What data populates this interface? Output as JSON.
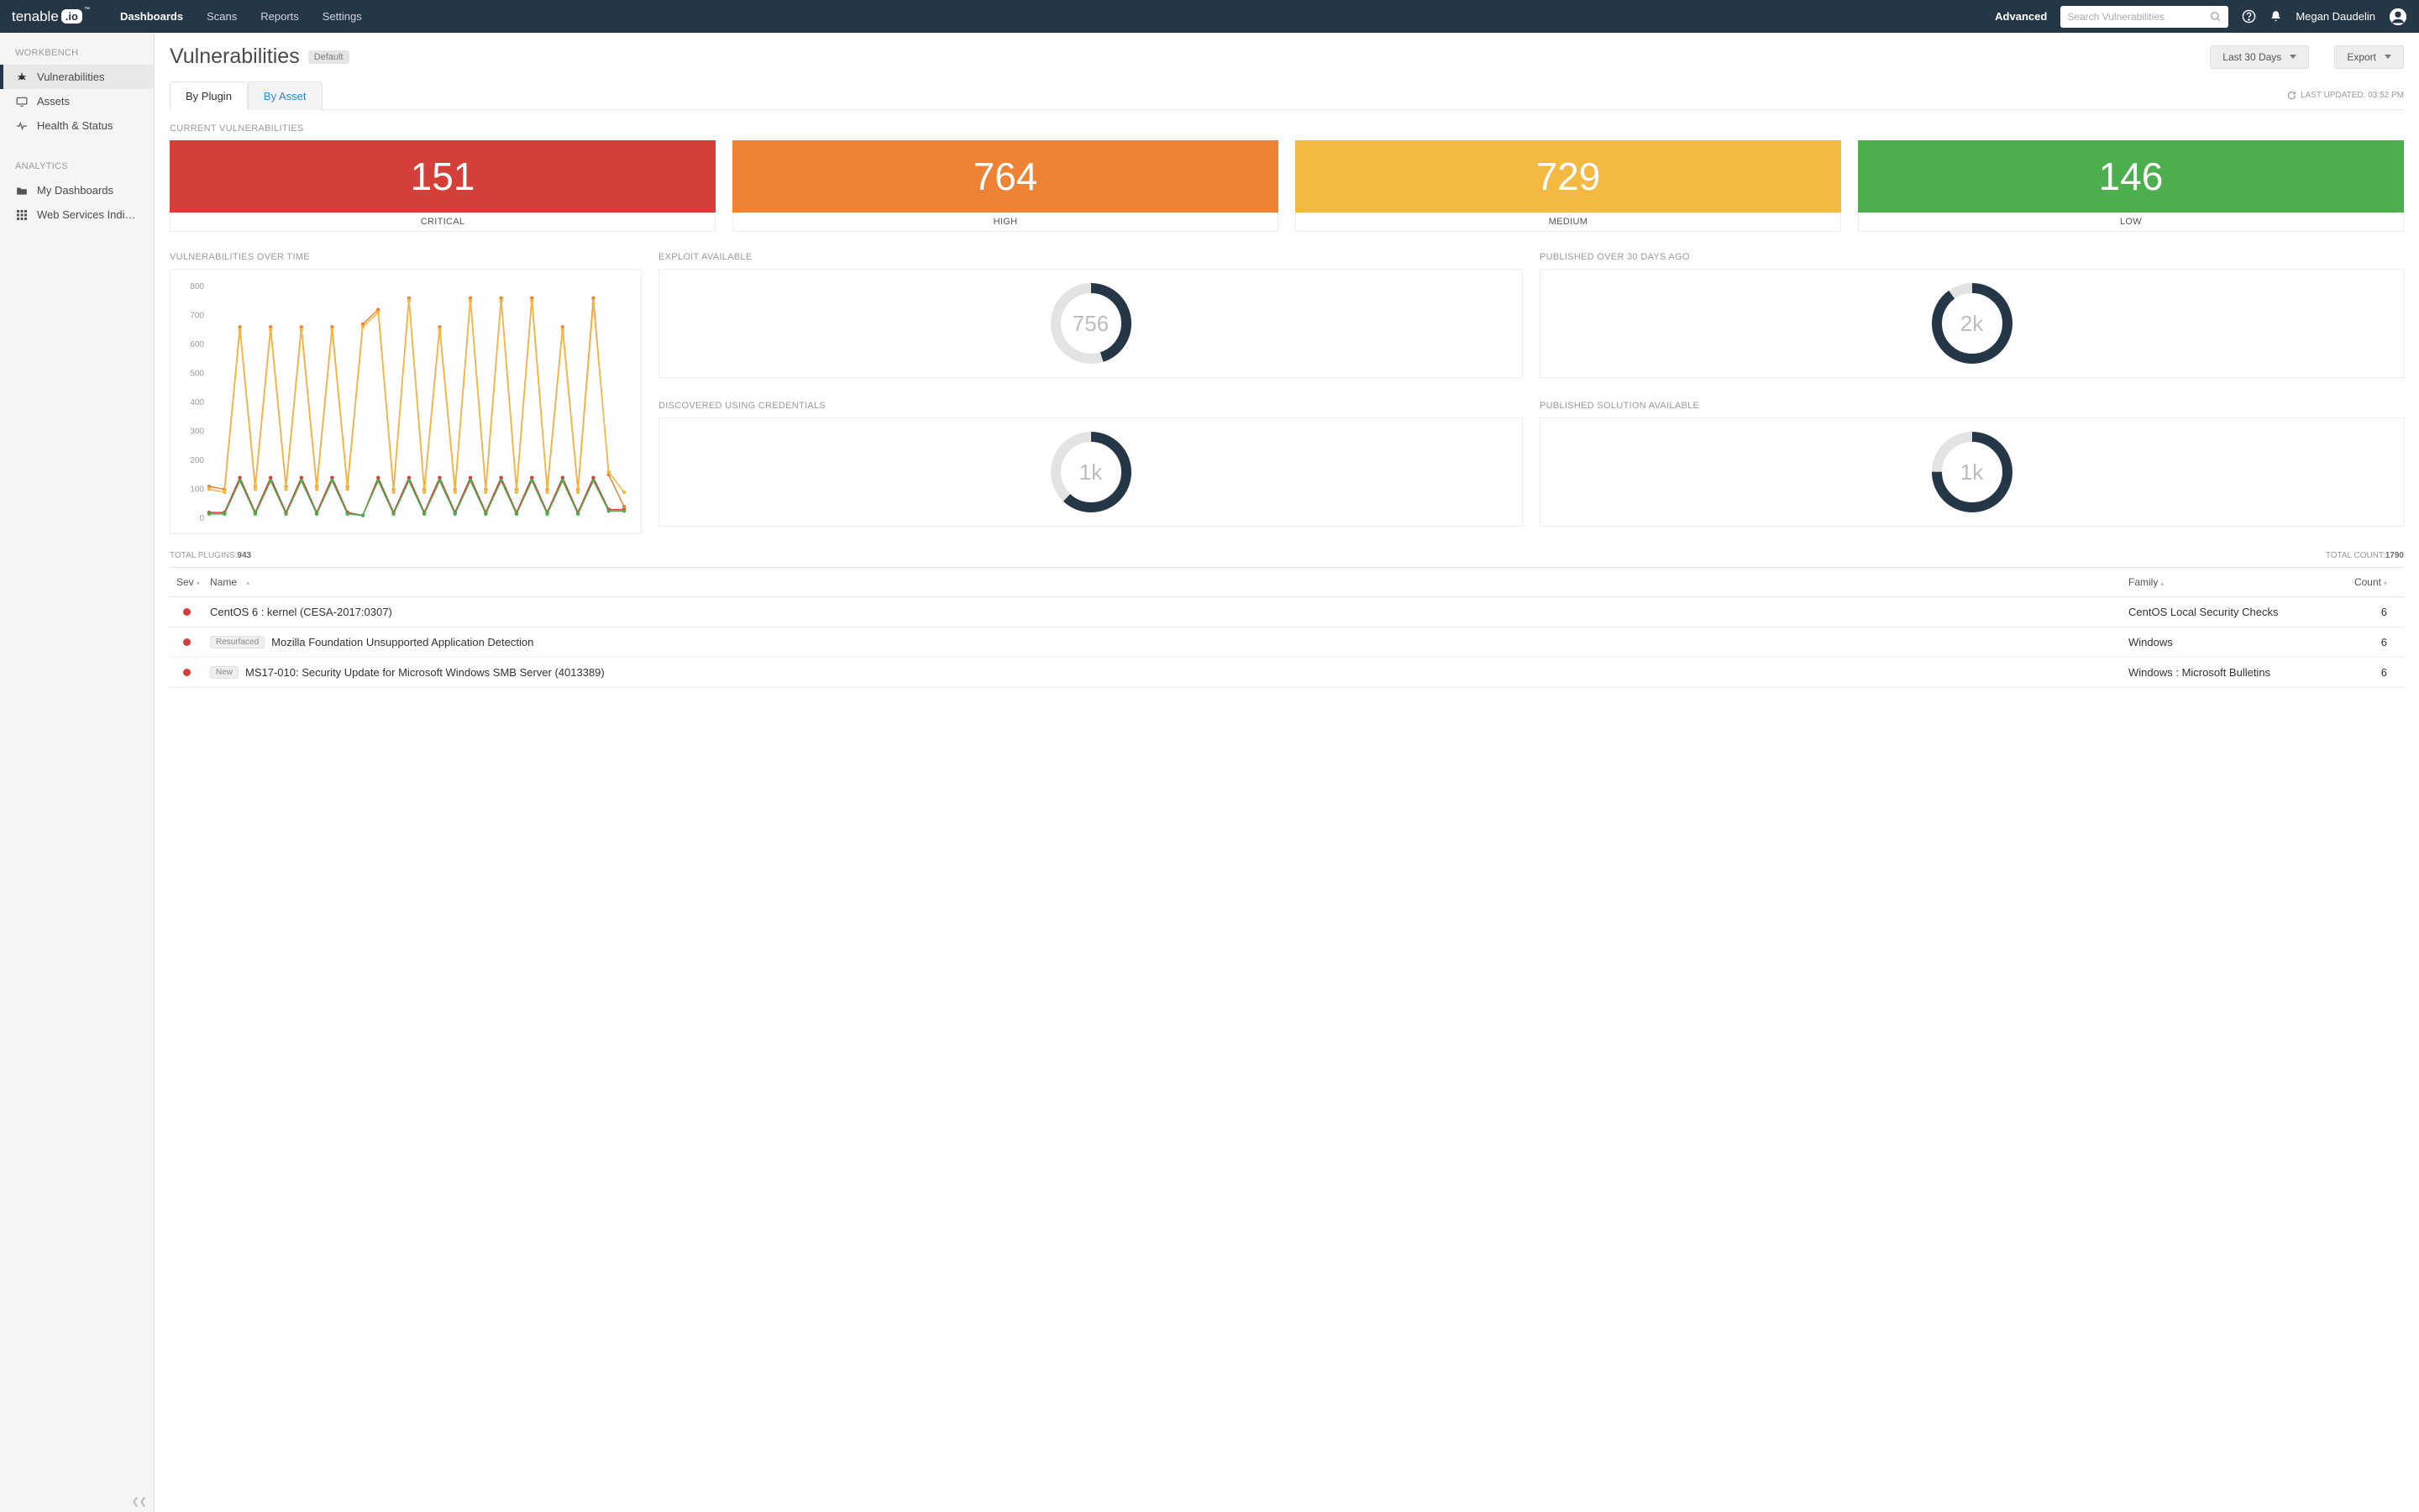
{
  "brand": {
    "left": "tenable",
    "badge": ".io",
    "tm": "™"
  },
  "topnav": [
    "Dashboards",
    "Scans",
    "Reports",
    "Settings"
  ],
  "topnav_active": 0,
  "advanced_label": "Advanced",
  "search_placeholder": "Search Vulnerabilities",
  "username": "Megan Daudelin",
  "sidebar": {
    "section1": "WORKBENCH",
    "items1": [
      "Vulnerabilities",
      "Assets",
      "Health & Status"
    ],
    "active1": 0,
    "section2": "ANALYTICS",
    "items2": [
      "My Dashboards",
      "Web Services Indi…"
    ]
  },
  "page": {
    "title": "Vulnerabilities",
    "default_chip": "Default",
    "range_btn": "Last 30 Days",
    "export_btn": "Export"
  },
  "tabs": {
    "by_plugin": "By Plugin",
    "by_asset": "By Asset",
    "active": 0
  },
  "last_updated_label": "LAST UPDATED: 03:52 PM",
  "sections": {
    "current": "CURRENT VULNERABILITIES",
    "over_time": "VULNERABILITIES OVER TIME",
    "exploit": "EXPLOIT AVAILABLE",
    "published30": "PUBLISHED OVER 30 DAYS AGO",
    "cred": "DISCOVERED USING CREDENTIALS",
    "solution": "PUBLISHED SOLUTION AVAILABLE"
  },
  "severity": {
    "critical": {
      "value": "151",
      "label": "CRITICAL"
    },
    "high": {
      "value": "764",
      "label": "HIGH"
    },
    "medium": {
      "value": "729",
      "label": "MEDIUM"
    },
    "low": {
      "value": "146",
      "label": "LOW"
    }
  },
  "donuts": {
    "exploit": {
      "value": "756",
      "fraction": 0.45
    },
    "published30": {
      "value": "2k",
      "fraction": 0.9
    },
    "cred": {
      "value": "1k",
      "fraction": 0.62
    },
    "solution": {
      "value": "1k",
      "fraction": 0.75
    }
  },
  "totals": {
    "plugins_label": "TOTAL PLUGINS: ",
    "plugins": "943",
    "count_label": "TOTAL COUNT: ",
    "count": "1790"
  },
  "table": {
    "headers": {
      "sev": "Sev",
      "name": "Name",
      "family": "Family",
      "count": "Count"
    },
    "rows": [
      {
        "sev": "critical",
        "tag": "",
        "name": "CentOS 6 : kernel (CESA-2017:0307)",
        "family": "CentOS Local Security Checks",
        "count": "6"
      },
      {
        "sev": "critical",
        "tag": "Resurfaced",
        "name": "Mozilla Foundation Unsupported Application Detection",
        "family": "Windows",
        "count": "6"
      },
      {
        "sev": "critical",
        "tag": "New",
        "name": "MS17-010: Security Update for Microsoft Windows SMB Server (4013389)",
        "family": "Windows : Microsoft Bulletins",
        "count": "6"
      }
    ]
  },
  "chart_data": {
    "type": "line",
    "ylabel": "",
    "ylim": [
      0,
      800
    ],
    "yticks": [
      0,
      100,
      200,
      300,
      400,
      500,
      600,
      700,
      800
    ],
    "x_count": 28,
    "series": [
      {
        "name": "critical",
        "color": "#d43f3a",
        "values": [
          20,
          20,
          140,
          20,
          140,
          20,
          140,
          20,
          140,
          20,
          10,
          140,
          20,
          140,
          20,
          140,
          20,
          140,
          20,
          140,
          20,
          140,
          20,
          140,
          20,
          140,
          30,
          30
        ]
      },
      {
        "name": "high",
        "color": "#ee8336",
        "values": [
          110,
          100,
          660,
          110,
          660,
          110,
          660,
          110,
          660,
          110,
          670,
          720,
          100,
          760,
          100,
          660,
          100,
          760,
          100,
          760,
          100,
          760,
          100,
          660,
          100,
          760,
          150,
          40
        ]
      },
      {
        "name": "medium",
        "color": "#f4b940",
        "values": [
          100,
          90,
          650,
          100,
          650,
          100,
          650,
          100,
          650,
          100,
          660,
          710,
          90,
          750,
          90,
          650,
          90,
          750,
          90,
          750,
          90,
          750,
          90,
          650,
          90,
          740,
          160,
          90
        ]
      },
      {
        "name": "low",
        "color": "#4cae4c",
        "values": [
          15,
          15,
          130,
          15,
          130,
          15,
          130,
          15,
          130,
          15,
          10,
          130,
          15,
          130,
          15,
          130,
          15,
          130,
          15,
          130,
          15,
          130,
          15,
          130,
          15,
          130,
          25,
          25
        ]
      }
    ]
  }
}
